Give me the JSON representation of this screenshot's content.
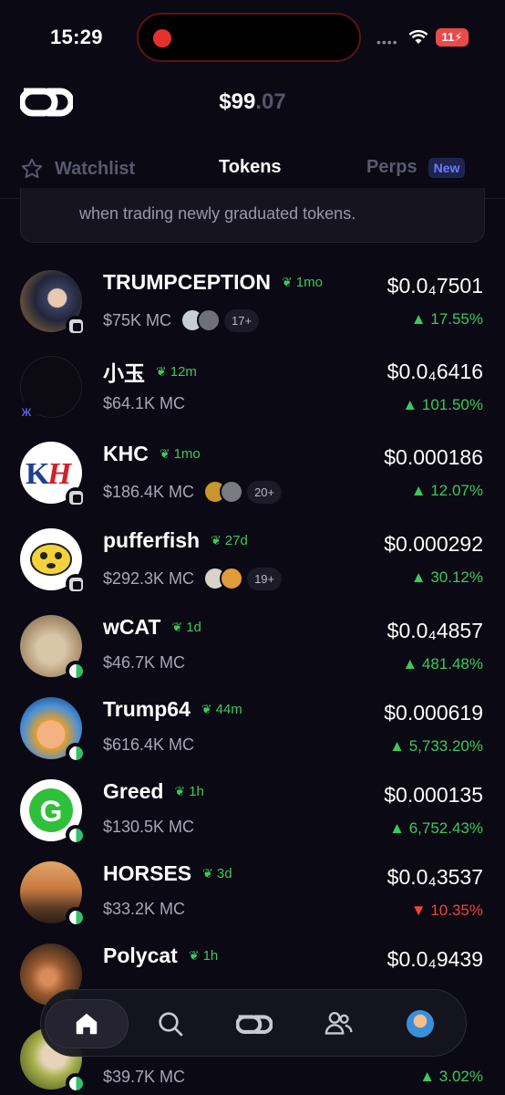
{
  "status_bar": {
    "time": "15:29",
    "battery": "11"
  },
  "header": {
    "balance_main": "$99",
    "balance_fraction": ".07"
  },
  "tabs": [
    {
      "label": "Watchlist",
      "active": false
    },
    {
      "label": "Tokens",
      "active": true
    },
    {
      "label": "Perps",
      "active": false,
      "badge": "New"
    }
  ],
  "info_card": {
    "text": "when trading newly graduated tokens."
  },
  "tokens": [
    {
      "name": "TRUMPCEPTION",
      "age": "1mo",
      "mc": "$75K MC",
      "holders": "17+",
      "price": "$0.0₄7501",
      "change": "17.55%",
      "direction": "up"
    },
    {
      "name": "小玉",
      "age": "12m",
      "mc": "$64.1K MC",
      "holders": "",
      "price": "$0.0₄6416",
      "change": "101.50%",
      "direction": "up"
    },
    {
      "name": "KHC",
      "age": "1mo",
      "mc": "$186.4K MC",
      "holders": "20+",
      "price": "$0.000186",
      "change": "12.07%",
      "direction": "up"
    },
    {
      "name": "pufferfish",
      "age": "27d",
      "mc": "$292.3K MC",
      "holders": "19+",
      "price": "$0.000292",
      "change": "30.12%",
      "direction": "up"
    },
    {
      "name": "wCAT",
      "age": "1d",
      "mc": "$46.7K MC",
      "holders": "",
      "price": "$0.0₄4857",
      "change": "481.48%",
      "direction": "up"
    },
    {
      "name": "Trump64",
      "age": "44m",
      "mc": "$616.4K MC",
      "holders": "",
      "price": "$0.000619",
      "change": "5,733.20%",
      "direction": "up"
    },
    {
      "name": "Greed",
      "age": "1h",
      "mc": "$130.5K MC",
      "holders": "",
      "price": "$0.000135",
      "change": "6,752.43%",
      "direction": "up"
    },
    {
      "name": "HORSES",
      "age": "3d",
      "mc": "$33.2K MC",
      "holders": "",
      "price": "$0.0₄3537",
      "change": "10.35%",
      "direction": "down"
    },
    {
      "name": "Polycat",
      "age": "1h",
      "mc": "",
      "holders": "",
      "price": "$0.0₄9439",
      "change": "",
      "direction": "up"
    },
    {
      "name": "",
      "age": "",
      "mc": "$39.7K MC",
      "holders": "",
      "price": "",
      "change": "3.02%",
      "direction": "up"
    }
  ],
  "icons": {
    "up_arrow": "▲",
    "down_arrow": "▼",
    "sprout": "sprout-icon"
  },
  "colors": {
    "accent": "#4a63ff",
    "positive": "#3ec85a",
    "negative": "#f0453a",
    "background": "#0a0914"
  }
}
